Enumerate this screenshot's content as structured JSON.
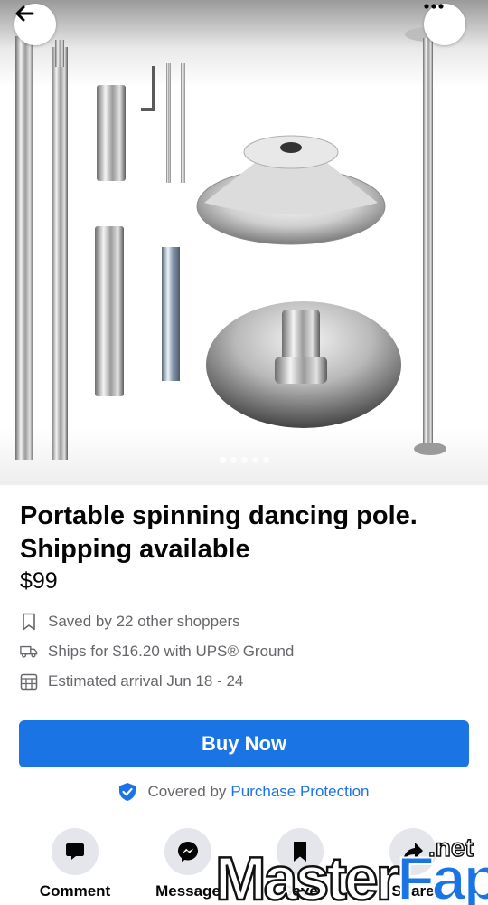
{
  "listing": {
    "title": "Portable spinning dancing pole. Shipping available",
    "price": "$99",
    "image_count": 5,
    "active_image": 0
  },
  "details": {
    "saved": "Saved by 22 other shoppers",
    "shipping": "Ships for $16.20 with UPS® Ground",
    "arrival": "Estimated arrival Jun 18 - 24"
  },
  "buy_button": "Buy Now",
  "protection": {
    "prefix": "Covered by",
    "link": "Purchase Protection"
  },
  "actions": [
    {
      "label": "Comment",
      "icon": "comment-icon"
    },
    {
      "label": "Message",
      "icon": "messenger-icon"
    },
    {
      "label": "Save",
      "icon": "bookmark-icon"
    },
    {
      "label": "Share",
      "icon": "share-icon"
    }
  ],
  "watermark": {
    "text": "MasterFap",
    "suffix": ".net"
  },
  "colors": {
    "accent": "#1b74e4",
    "secondary_text": "#65676b",
    "button_bg": "#e4e6eb"
  }
}
